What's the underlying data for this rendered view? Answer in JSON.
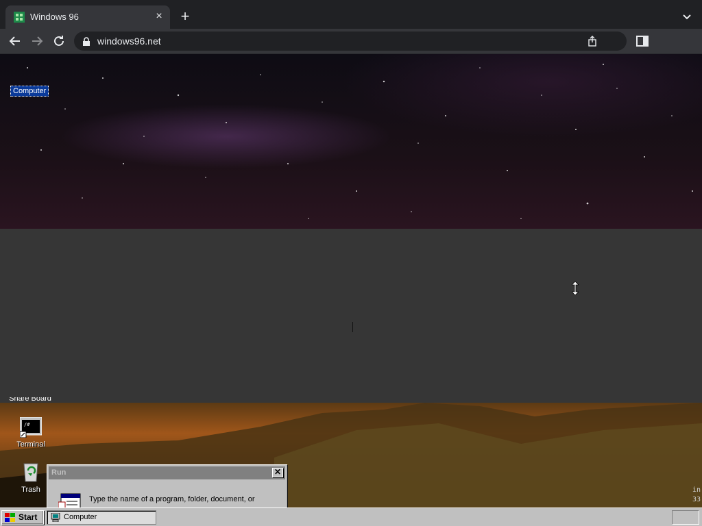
{
  "browser": {
    "tab_title": "Windows 96",
    "tab_close": "×",
    "new_tab": "+",
    "url": "windows96.net"
  },
  "desktop": {
    "computer_label": "Computer",
    "shareboard_label": "Share Board",
    "terminal_label": "Terminal",
    "terminal_glyph": "/#",
    "trash_label": "Trash"
  },
  "run_dialog": {
    "title": "Run",
    "close": "✕",
    "prompt": "Type the name of a program, folder, document, or"
  },
  "side_text": [
    "in",
    "33"
  ],
  "taskbar": {
    "start_label": "Start",
    "task_label": "Computer"
  },
  "colors": {
    "browser_bg": "#202124",
    "toolbar_bg": "#35363a",
    "win95_gray": "#c0c0c0",
    "selection_blue": "#0a3a9a"
  }
}
